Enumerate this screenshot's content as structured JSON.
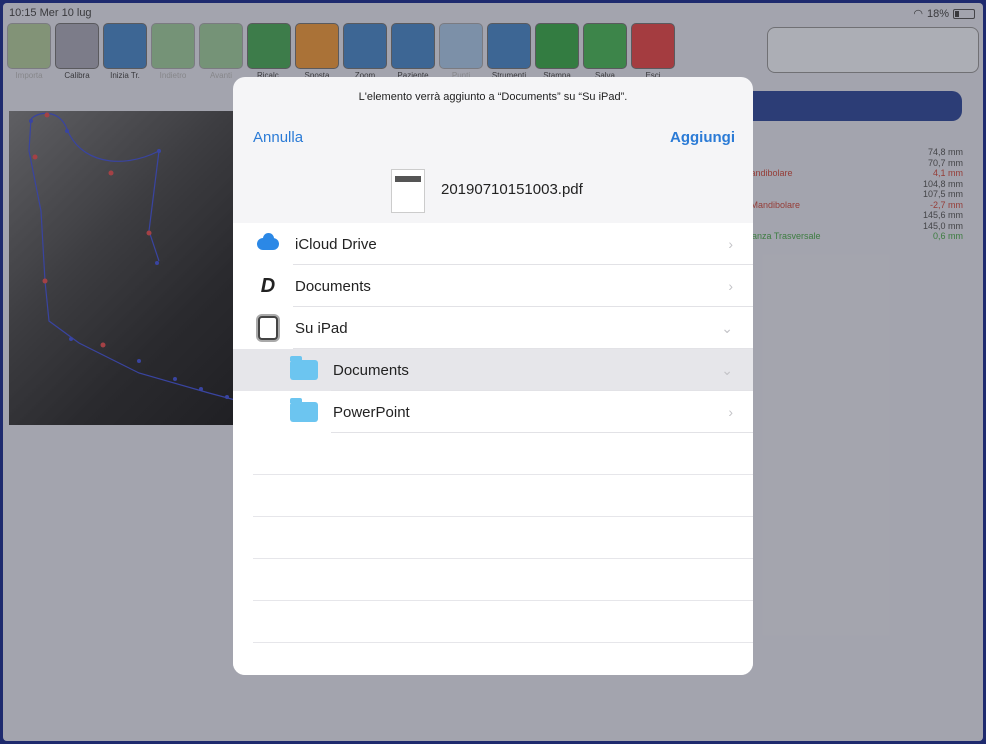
{
  "status": {
    "time": "10:15  Mer 10 lug",
    "battery": "18%"
  },
  "toolbar": [
    {
      "label": "Importa",
      "icon": "import-icon",
      "color": "#7aa84a",
      "dim": true
    },
    {
      "label": "Calibra",
      "icon": "ruler-icon",
      "color": "#9a9aa8",
      "dim": false
    },
    {
      "label": "Inizia Tr.",
      "icon": "start-trace-icon",
      "color": "#3a78b8",
      "dim": false
    },
    {
      "label": "Indietro",
      "icon": "undo-icon",
      "color": "#58a848",
      "dim": true
    },
    {
      "label": "Avanti",
      "icon": "redo-icon",
      "color": "#58a848",
      "dim": true
    },
    {
      "label": "Ricalc.",
      "icon": "recalc-icon",
      "color": "#3a9a48",
      "dim": false
    },
    {
      "label": "Sposta",
      "icon": "move-icon",
      "color": "#e08a2a",
      "dim": false
    },
    {
      "label": "Zoom",
      "icon": "zoom-icon",
      "color": "#3a78b8",
      "dim": false
    },
    {
      "label": "Paziente",
      "icon": "patient-icon",
      "color": "#3a78b8",
      "dim": false
    },
    {
      "label": "Punti",
      "icon": "points-icon",
      "color": "#6aa0d0",
      "dim": true
    },
    {
      "label": "Strumenti",
      "icon": "tools-icon",
      "color": "#3a78b8",
      "dim": false
    },
    {
      "label": "Stampa",
      "icon": "print-icon",
      "color": "#2a9a3a",
      "dim": false
    },
    {
      "label": "Salva",
      "icon": "save-icon",
      "color": "#3aa848",
      "dim": false
    },
    {
      "label": "Esci",
      "icon": "exit-icon",
      "color": "#d83838",
      "dim": false
    }
  ],
  "measures": [
    {
      "name": "",
      "value": "74,8 mm",
      "tone": "normal"
    },
    {
      "name": "",
      "value": "70,7 mm",
      "tone": "normal"
    },
    {
      "name": "Mandibolare",
      "value": "4,1 mm",
      "tone": "red"
    },
    {
      "name": "",
      "value": "104,8 mm",
      "tone": "normal"
    },
    {
      "name": "",
      "value": "107,5 mm",
      "tone": "normal"
    },
    {
      "name": "e Mandibolare",
      "value": "-2,7 mm",
      "tone": "red"
    },
    {
      "name": "",
      "value": "145,6 mm",
      "tone": "normal"
    },
    {
      "name": "",
      "value": "145,0 mm",
      "tone": "normal"
    },
    {
      "name": "istanza Trasversale",
      "value": "0,6 mm",
      "tone": "green"
    }
  ],
  "dialog": {
    "message": "L'elemento verrà aggiunto a “Documents” su “Su iPad”.",
    "cancel": "Annulla",
    "add": "Aggiungi",
    "file_name": "20190710151003.pdf",
    "locations": [
      {
        "label": "iCloud Drive",
        "icon": "icloud-icon",
        "chevron": "›",
        "sub": false,
        "selected": false
      },
      {
        "label": "Documents",
        "icon": "documents-app-icon",
        "chevron": "›",
        "sub": false,
        "selected": false
      },
      {
        "label": "Su iPad",
        "icon": "ipad-icon",
        "chevron": "⌄",
        "sub": false,
        "selected": false
      },
      {
        "label": "Documents",
        "icon": "folder-icon",
        "chevron": "⌄",
        "sub": true,
        "selected": true
      },
      {
        "label": "PowerPoint",
        "icon": "folder-icon",
        "chevron": "›",
        "sub": true,
        "selected": false
      }
    ]
  }
}
